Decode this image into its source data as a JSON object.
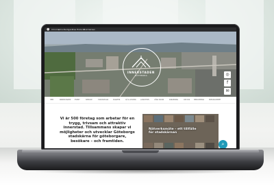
{
  "website": {
    "menubar": {
      "items": [
        "Chrome",
        "Arkiv",
        "Redigera",
        "Visa",
        "Historik",
        "Bokmärken",
        "Profiler",
        "Flik",
        "Fönster",
        "Hjälp"
      ]
    },
    "logo": {
      "title": "INNERSTADEN",
      "subtitle": "GÖTEBORG"
    },
    "social_icons": [
      "instagram-icon",
      "facebook-icon",
      "mail-icon"
    ],
    "nav": {
      "items": [
        "HEM",
        "INNERSTADEN",
        "EVENT",
        "SERVICE",
        "STADSDELAR",
        "KVARTER",
        "GÅ & SHOPPA",
        "LUNCHTIPS",
        "VÅRA SIDOR",
        "PARKERING",
        "OM OSS",
        "MEDLEMMAR",
        "PRESSRUMMET"
      ]
    },
    "intro_text": "Vi är 500 företag som arbetar för en trygg, trivsam och attraktiv innerstad. Tillsammans skapar vi möjligheter och utvecklar Göteborgs stadskärna för göteborgare, besökare – och framtiden.",
    "video_caption": "Nätverksmöte – ett tillfälle för stadskärnan",
    "chat_icon": "search-icon"
  },
  "colors": {
    "accent": "#1e9ab8",
    "text": "#1f1f1f",
    "laptop_bezel": "#1a1a1c"
  }
}
